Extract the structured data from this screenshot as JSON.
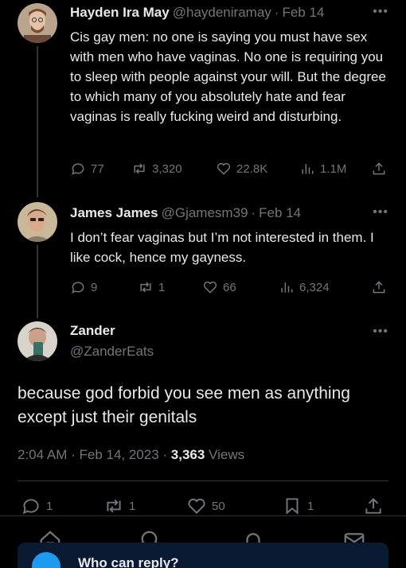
{
  "tweets": [
    {
      "name": "Hayden Ira May",
      "handle": "@haydeniramay",
      "separator": "·",
      "date": "Feb 14",
      "more": "•••",
      "text": "Cis gay men: no one is saying you must have sex with men who have vaginas. No one is requiring you to sleep with people against your will. But the degree to which many of you absolutely hate and fear vaginas is really fucking weird and disturbing.",
      "replies": "77",
      "reposts": "3,320",
      "likes": "22.8K",
      "views": "1.1M"
    },
    {
      "name": "James James",
      "handle": "@Gjamesm39",
      "separator": "·",
      "date": "Feb 14",
      "more": "•••",
      "text": "I don’t fear vaginas but I’m not interested in them. I like cock, hence my gayness.",
      "replies": "9",
      "reposts": "1",
      "likes": "66",
      "views": "6,324"
    }
  ],
  "main": {
    "name": "Zander",
    "handle": "@ZanderEats",
    "more": "•••",
    "text": "because god forbid you see men as anything except just their genitals",
    "time": "2:04 AM · Feb 14, 2023 · ",
    "views_count": "3,363",
    "views_label": " Views",
    "replies": "1",
    "reposts": "1",
    "likes": "50",
    "bookmarks": "1"
  },
  "reply_prompt": "Who can reply?",
  "icons": {
    "reply": "reply-icon",
    "repost": "repost-icon",
    "like": "heart-icon",
    "views": "views-icon",
    "share": "share-icon",
    "bookmark": "bookmark-icon",
    "home": "home-icon",
    "search": "search-icon",
    "notifications": "bell-icon",
    "messages": "mail-icon"
  },
  "colors": {
    "background": "#000000",
    "text": "#e7e9ea",
    "muted": "#71767b",
    "accent": "#1d9bf0"
  }
}
